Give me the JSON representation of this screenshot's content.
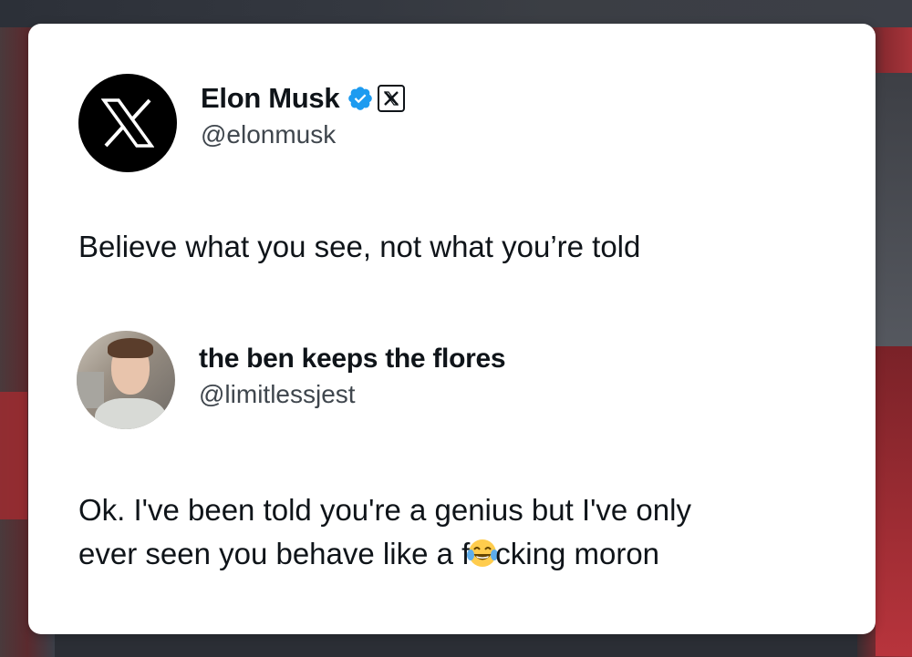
{
  "post": {
    "author_name": "Elon Musk",
    "author_handle": "@elonmusk",
    "text": "Believe what you see, not what you’re told",
    "avatar_icon": "x-logo-icon",
    "verified_icon": "verified-badge-icon",
    "affiliation_icon": "x-affiliate-badge-icon"
  },
  "reply": {
    "author_name": "the ben keeps the flores",
    "author_handle": "@limitlessjest",
    "text_line1": "Ok. I've been told you're a genius but I've only",
    "text_line2_prefix": "ever seen you behave like a f",
    "text_line2_suffix": "cking moron",
    "emoji": "face-with-tears-of-joy-icon"
  },
  "colors": {
    "text": "#0f1419",
    "muted": "#3f464d",
    "verified": "#1d9bf0",
    "card": "#ffffff"
  }
}
